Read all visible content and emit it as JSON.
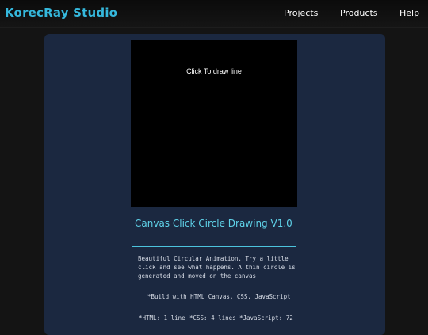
{
  "header": {
    "brand": "KorecRay Studio",
    "nav": [
      "Projects",
      "Products",
      "Help"
    ]
  },
  "demo": {
    "canvas_hint": "Click To draw line",
    "title": "Canvas Click Circle Drawing V1.0",
    "description": "Beautiful Circular Animation. Try a little click and see what happens. A thin circle is generated and moved on the canvas",
    "build_note": "*Build with HTML Canvas, CSS, JavaScript",
    "stats": {
      "html": "*HTML: 1 line",
      "css": "*CSS: 4 lines",
      "js": "*JavaScript: 72"
    }
  },
  "colors": {
    "page_bg": "#141414",
    "panel_bg": "#1b2840",
    "brand": "#35b8dc",
    "accent": "#5fd2e8",
    "canvas": "#000000"
  }
}
